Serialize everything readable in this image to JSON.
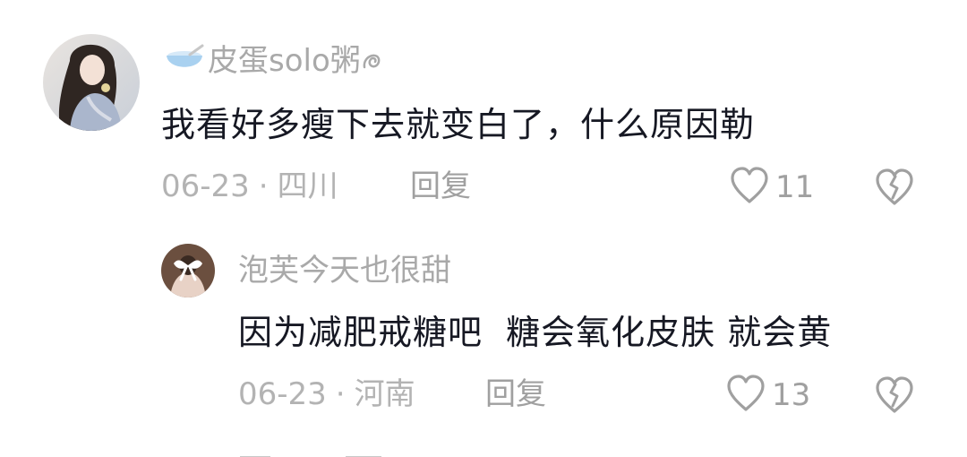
{
  "comments": [
    {
      "username": "皮蛋solo粥",
      "text": "我看好多瘦下去就变白了，什么原因勒",
      "date": "06-23",
      "location": "四川",
      "reply_label": "回复",
      "likes": "11"
    }
  ],
  "replies": [
    {
      "username": "泡芙今天也很甜",
      "text": "因为减肥戒糖吧  糖会氧化皮肤 就会黄",
      "date": "06-23",
      "location": "河南",
      "reply_label": "回复",
      "likes": "13"
    }
  ],
  "meta_separator": "·",
  "icons": {
    "like": "heart-outline-icon",
    "dislike": "broken-heart-icon",
    "username_prefix": "bowl-icon",
    "username_suffix": "curl-icon"
  },
  "colors": {
    "text_primary": "#161823",
    "text_secondary": "#a9a9a9",
    "icon": "#a0a0a0",
    "background": "#ffffff"
  }
}
